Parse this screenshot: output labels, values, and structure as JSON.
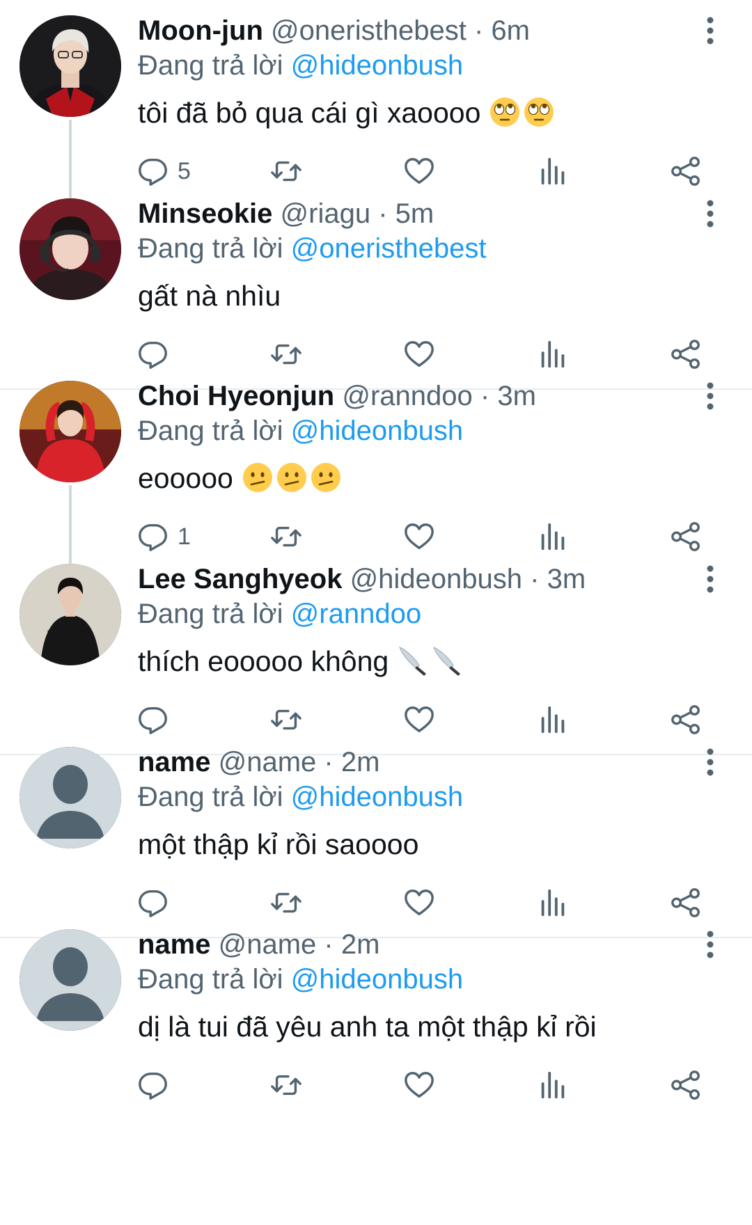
{
  "tweets": [
    {
      "name": "Moon-jun",
      "handle": "@oneristhebest",
      "dot": "·",
      "time": "6m",
      "reply_prefix": "Đang trả lời",
      "reply_to": "@hideonbush",
      "text": "tôi đã bỏ qua cái gì xaoooo",
      "emojis": [
        "eye-roll-emoji",
        "eye-roll-emoji"
      ],
      "reply_count": "5",
      "avatar": "avatar-photo-red-jersey"
    },
    {
      "name": "Minseokie",
      "handle": "@riagu",
      "dot": "·",
      "time": "5m",
      "reply_prefix": "Đang trả lời",
      "reply_to": "@oneristhebest",
      "text": "gất nà nhìu",
      "emojis": [],
      "reply_count": "",
      "avatar": "avatar-photo-headset"
    },
    {
      "name": "Choi Hyeonjun",
      "handle": "@ranndoo",
      "dot": "·",
      "time": "3m",
      "reply_prefix": "Đang trả lời",
      "reply_to": "@hideonbush",
      "text": "eooooo",
      "emojis": [
        "confused-face-emoji",
        "confused-face-emoji",
        "confused-face-emoji"
      ],
      "reply_count": "1",
      "avatar": "avatar-photo-red-jacket"
    },
    {
      "name": "Lee Sanghyeok",
      "handle": "@hideonbush",
      "dot": "·",
      "time": "3m",
      "reply_prefix": "Đang trả lời",
      "reply_to": "@ranndoo",
      "text": "thích eooooo không",
      "emojis": [
        "knife-emoji",
        "knife-emoji"
      ],
      "reply_count": "",
      "avatar": "avatar-photo-black-outfit"
    },
    {
      "name": "name",
      "handle": "@name",
      "dot": "·",
      "time": "2m",
      "reply_prefix": "Đang trả lời",
      "reply_to": "@hideonbush",
      "text": "một thập kỉ rồi saoooo",
      "emojis": [],
      "reply_count": "",
      "avatar": "default-avatar"
    },
    {
      "name": "name",
      "handle": "@name",
      "dot": "·",
      "time": "2m",
      "reply_prefix": "Đang trả lời",
      "reply_to": "@hideonbush",
      "text": "dị là tui đã yêu anh ta một thập kỉ rồi",
      "emojis": [],
      "reply_count": "",
      "avatar": "default-avatar"
    }
  ],
  "colors": {
    "link": "#1d9bf0",
    "secondary_text": "#536471",
    "primary_text": "#0f1419",
    "thread_line": "#cfd9de",
    "divider": "#e6ecf0",
    "default_avatar_bg": "#cfd9de",
    "default_avatar_fg": "#536471"
  },
  "icons": {
    "more": "more-vertical-icon",
    "reply": "reply-icon",
    "retweet": "retweet-icon",
    "like": "heart-icon",
    "views": "analytics-icon",
    "share": "share-icon"
  }
}
